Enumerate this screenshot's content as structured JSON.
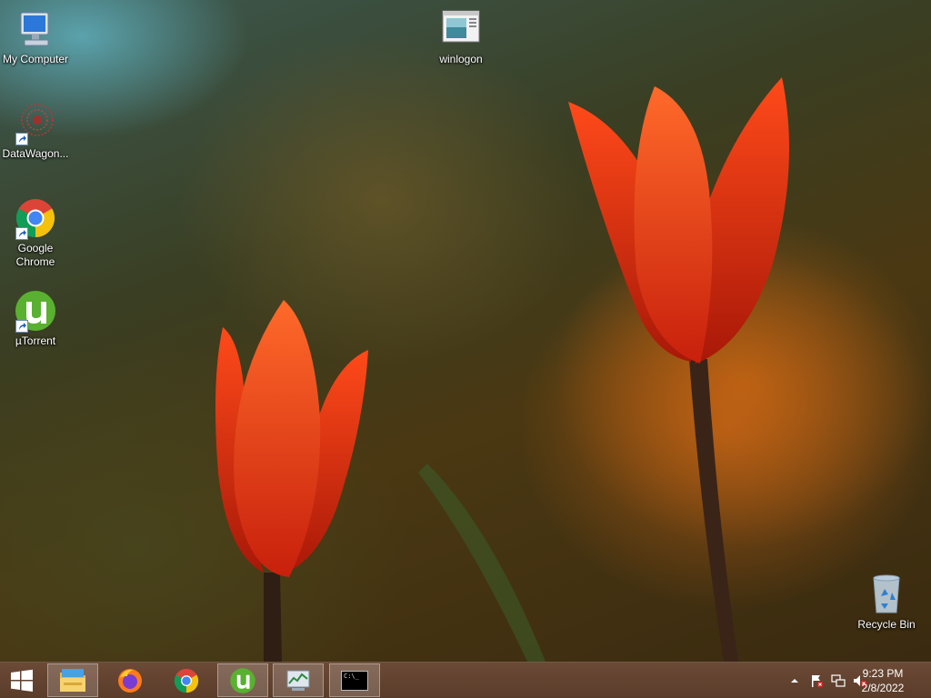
{
  "desktop": {
    "icons": [
      {
        "id": "my-computer",
        "label": "My Computer"
      },
      {
        "id": "datawagon",
        "label": "DataWagon..."
      },
      {
        "id": "google-chrome",
        "label": "Google Chrome"
      },
      {
        "id": "utorrent",
        "label": "µTorrent"
      },
      {
        "id": "winlogon",
        "label": "winlogon"
      },
      {
        "id": "recycle-bin",
        "label": "Recycle Bin"
      }
    ]
  },
  "taskbar": {
    "pinned": [
      {
        "name": "File Explorer",
        "icon": "folder-icon",
        "active": true
      },
      {
        "name": "Firefox",
        "icon": "firefox-icon",
        "active": false
      },
      {
        "name": "Google Chrome",
        "icon": "chrome-icon",
        "active": false
      },
      {
        "name": "µTorrent",
        "icon": "utorrent-icon",
        "active": true
      },
      {
        "name": "Task Manager",
        "icon": "task-manager-icon",
        "active": true
      },
      {
        "name": "Command Prompt",
        "icon": "command-prompt-icon",
        "active": true
      }
    ],
    "cmd_text": "C:\\_",
    "clock": {
      "time": "9:23 PM",
      "date": "2/8/2022"
    }
  },
  "colors": {
    "taskbar": "#5e402e",
    "chrome_red": "#db4437",
    "chrome_yellow": "#f4c20d",
    "chrome_green": "#0f9d58",
    "chrome_blue": "#4285f4",
    "utorrent_green": "#5ab030"
  }
}
